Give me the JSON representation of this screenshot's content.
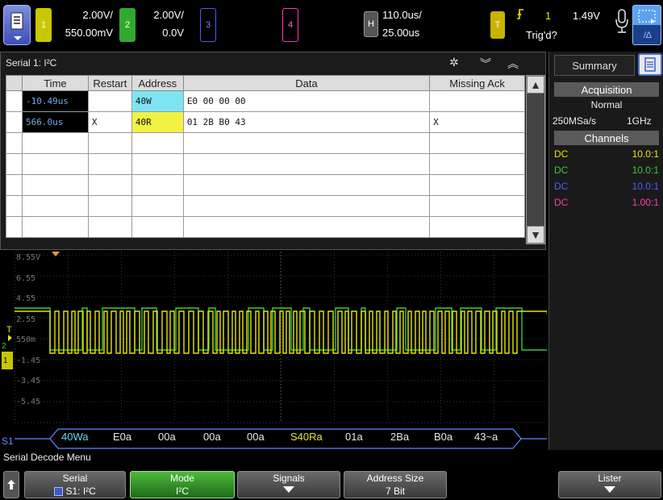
{
  "topbar": {
    "ch1": {
      "num": "1",
      "scale": "2.00V/",
      "offset": "550.00mV",
      "color": "#e6e600"
    },
    "ch2": {
      "num": "2",
      "scale": "2.00V/",
      "offset": "0.0V",
      "color": "#3cc83c"
    },
    "ch3": {
      "num": "3",
      "color": "#4a5cff"
    },
    "ch4": {
      "num": "4",
      "color": "#ff3cb4"
    },
    "horiz": {
      "label": "H",
      "scale": "110.0us/",
      "delay": "25.00us"
    },
    "trigger": {
      "label": "T",
      "source": "1",
      "level": "1.49V",
      "status": "Trig'd?"
    }
  },
  "lister": {
    "title": "Serial 1: I²C",
    "columns": [
      "Time",
      "Restart",
      "Address",
      "Data",
      "Missing Ack"
    ],
    "rows": [
      {
        "time": "-10.49us",
        "restart": "",
        "address": "40W",
        "data": "E0 00 00 00",
        "missing_ack": ""
      },
      {
        "time": "566.0us",
        "restart": "X",
        "address": "40R",
        "data": "01 2B B0 43",
        "missing_ack": "X"
      }
    ]
  },
  "sidebar": {
    "tab": "Summary",
    "acquisition_header": "Acquisition",
    "acq_mode": "Normal",
    "sample_rate": "250MSa/s",
    "bandwidth": "1GHz",
    "channels_header": "Channels",
    "channels": [
      {
        "coupling": "DC",
        "probe": "10.0:1",
        "color": "#e6e600"
      },
      {
        "coupling": "DC",
        "probe": "10.0:1",
        "color": "#3cc83c"
      },
      {
        "coupling": "DC",
        "probe": "10.0:1",
        "color": "#5060ff"
      },
      {
        "coupling": "DC",
        "probe": "1.00:1",
        "color": "#ff3cb4"
      }
    ]
  },
  "waveform": {
    "ticks": [
      "8.55V",
      "6.55",
      "4.55",
      "2.55",
      "550m",
      "-1.45",
      "-3.45",
      "-5.45"
    ],
    "bus_label": "S1",
    "bus": [
      {
        "text": "40Wa",
        "color": "#6fd8f0"
      },
      {
        "text": "E0a",
        "color": "#e8e8e8"
      },
      {
        "text": "00a",
        "color": "#e8e8e8"
      },
      {
        "text": "00a",
        "color": "#e8e8e8"
      },
      {
        "text": "00a",
        "color": "#e8e8e8"
      },
      {
        "text": "S40Ra",
        "color": "#e6e632"
      },
      {
        "text": "01a",
        "color": "#e8e8e8"
      },
      {
        "text": "2Ba",
        "color": "#e8e8e8"
      },
      {
        "text": "B0a",
        "color": "#e8e8e8"
      },
      {
        "text": "43~a",
        "color": "#e8e8e8"
      }
    ]
  },
  "menu": {
    "title": "Serial Decode Menu",
    "serial": {
      "label": "Serial",
      "value": "S1: I²C"
    },
    "mode": {
      "label": "Mode",
      "value": "I²C"
    },
    "signals": {
      "label": "Signals"
    },
    "address_size": {
      "label": "Address Size",
      "value": "7 Bit"
    },
    "lister": {
      "label": "Lister"
    }
  }
}
